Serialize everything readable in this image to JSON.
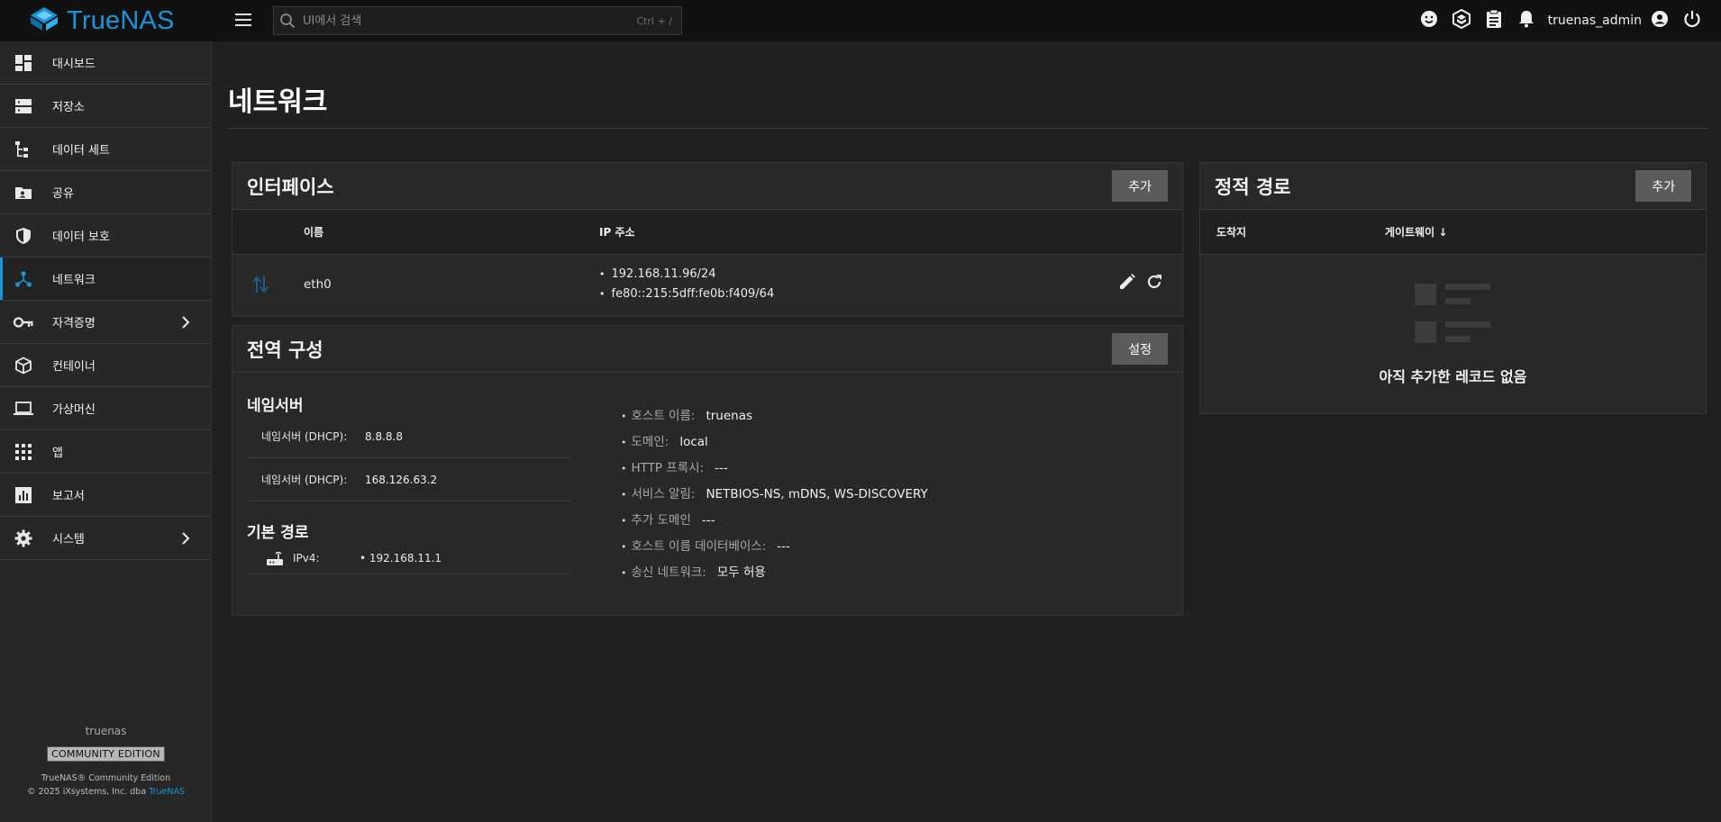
{
  "app": {
    "brand": "TrueNAS",
    "accent_color": "#1a94d8"
  },
  "topbar": {
    "search_placeholder": "UI에서 검색",
    "search_shortcut": "Ctrl + /",
    "username": "truenas_admin",
    "icons": [
      "feedback-icon",
      "truecommand-icon",
      "jobs-icon",
      "notifications-icon",
      "account-icon",
      "power-icon"
    ]
  },
  "sidebar": {
    "items": [
      {
        "label": "대시보드",
        "icon": "dashboard-icon"
      },
      {
        "label": "저장소",
        "icon": "storage-icon"
      },
      {
        "label": "데이터 세트",
        "icon": "datasets-icon"
      },
      {
        "label": "공유",
        "icon": "shares-icon"
      },
      {
        "label": "데이터 보호",
        "icon": "shield-icon"
      },
      {
        "label": "네트워크",
        "icon": "network-icon",
        "active": true
      },
      {
        "label": "자격증명",
        "icon": "key-icon",
        "expandable": true
      },
      {
        "label": "컨테이너",
        "icon": "container-icon"
      },
      {
        "label": "가상머신",
        "icon": "laptop-icon"
      },
      {
        "label": "앱",
        "icon": "apps-icon"
      },
      {
        "label": "보고서",
        "icon": "reports-icon"
      },
      {
        "label": "시스템",
        "icon": "gear-icon",
        "expandable": true
      }
    ],
    "footer": {
      "hostname": "truenas",
      "edition_badge": "COMMUNITY EDITION",
      "line1": "TrueNAS® Community Edition",
      "line2_prefix": "© 2025 iXsystems, Inc. dba ",
      "line2_link": "TrueNAS"
    }
  },
  "page": {
    "title": "네트워크"
  },
  "interfaces": {
    "title": "인터페이스",
    "add_button": "추가",
    "columns": {
      "name": "이름",
      "ip": "IP 주소"
    },
    "rows": [
      {
        "name": "eth0",
        "ips": [
          "192.168.11.96/24",
          "fe80::215:5dff:fe0b:f409/64"
        ]
      }
    ]
  },
  "global_config": {
    "title": "전역 구성",
    "settings_button": "설정",
    "nameservers_title": "네임서버",
    "nameservers": [
      {
        "label": "네임서버 (DHCP):",
        "value": "8.8.8.8"
      },
      {
        "label": "네임서버 (DHCP):",
        "value": "168.126.63.2"
      }
    ],
    "default_route_title": "기본 경로",
    "ipv4_label": "IPv4:",
    "ipv4_value": "192.168.11.1",
    "details": [
      {
        "label": "호스트 이름:",
        "value": "truenas"
      },
      {
        "label": "도메인:",
        "value": "local"
      },
      {
        "label": "HTTP 프록시:",
        "value": "---"
      },
      {
        "label": "서비스 알림:",
        "value": "NETBIOS-NS, mDNS, WS-DISCOVERY"
      },
      {
        "label": "추가 도메인",
        "value": "---"
      },
      {
        "label": "호스트 이름 데이터베이스:",
        "value": "---"
      },
      {
        "label": "송신 네트워크:",
        "value": "모두 허용"
      }
    ]
  },
  "static_routes": {
    "title": "정적 경로",
    "add_button": "추가",
    "columns": {
      "destination": "도착지",
      "gateway": "게이트웨이"
    },
    "sort_indicator": "↓",
    "empty_text": "아직 추가한 레코드 없음"
  }
}
